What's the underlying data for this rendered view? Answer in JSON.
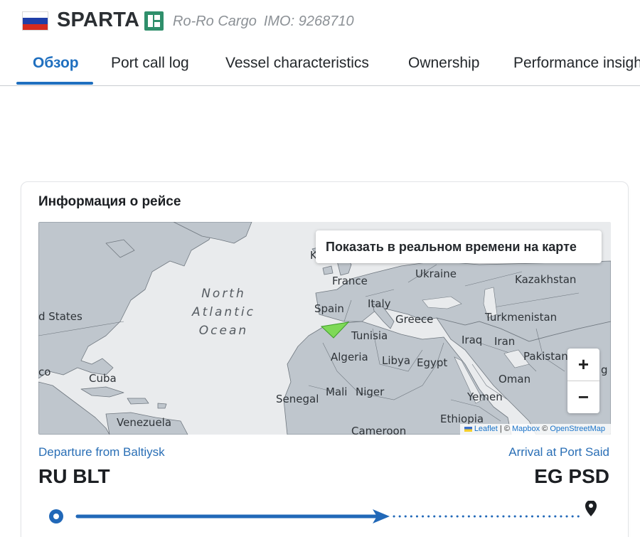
{
  "vessel": {
    "name": "SPARTA",
    "type": "Ro-Ro Cargo",
    "imo": "IMO: 9268710",
    "flag_country": "Russia",
    "flag_colors": [
      "#ffffff",
      "#1f3fa8",
      "#d52b1e"
    ],
    "class_badge_color": "#2f8f6b"
  },
  "tabs": [
    {
      "label": "Обзор",
      "active": true
    },
    {
      "label": "Port call log",
      "active": false
    },
    {
      "label": "Vessel characteristics",
      "active": false
    },
    {
      "label": "Ownership",
      "active": false
    },
    {
      "label": "Performance insigh",
      "active": false
    }
  ],
  "voyage": {
    "title": "Информация о рейсе",
    "map": {
      "realtime_button": "Показать в реальном времени на карте",
      "zoom_in": "+",
      "zoom_out": "−",
      "ocean_label": [
        "North",
        "Atlantic",
        "Ocean"
      ],
      "labels": [
        "d States",
        "Cuba",
        "co",
        "Venezuela",
        "France",
        "Spain",
        "Italy",
        "Greece",
        "Ukraine",
        "Kazakhstan",
        "Turkmenistan",
        "Tunisia",
        "Algeria",
        "Libya",
        "Egypt",
        "Iraq",
        "Iran",
        "Pakistan",
        "Oman",
        "Yemen",
        "Senegal",
        "Mali",
        "Niger",
        "Ethiopia",
        "Cameroon",
        "K",
        "g"
      ],
      "attribution": {
        "leaflet": "Leaflet",
        "sep": " | © ",
        "mapbox": "Mapbox",
        "sep2": " © ",
        "osm": "OpenStreetMap"
      },
      "colors": {
        "water": "#e9ebed",
        "land": "#bfc6cd",
        "borders": "#6f777f",
        "vessel_marker": "#7ed957"
      }
    },
    "departure_label": "Departure from Baltiysk",
    "arrival_label": "Arrival at Port Said",
    "departure_code": "RU BLT",
    "arrival_code": "EG PSD",
    "route_color": "#2168b8"
  }
}
